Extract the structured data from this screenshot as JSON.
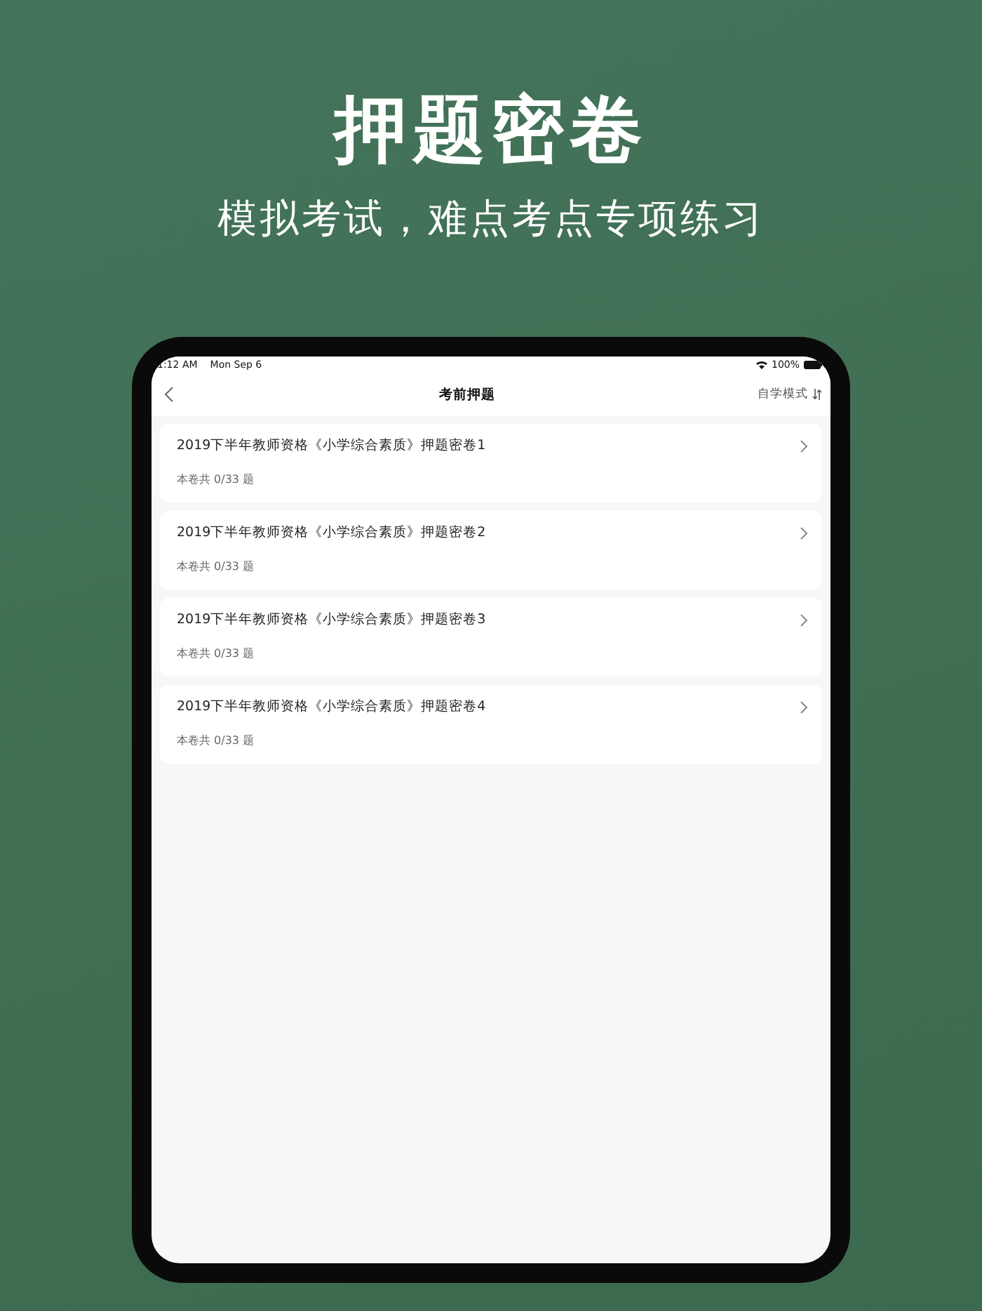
{
  "headline": "押题密卷",
  "subtitle": "模拟考试，难点考点专项练习",
  "status_bar": {
    "time": "1:12 AM",
    "date": "Mon Sep 6",
    "battery": "100%"
  },
  "nav_bar": {
    "title": "考前押题",
    "mode_button": "自学模式"
  },
  "papers": [
    {
      "title": "2019下半年教师资格《小学综合素质》押题密卷1",
      "progress": "本卷共 0/33 题"
    },
    {
      "title": "2019下半年教师资格《小学综合素质》押题密卷2",
      "progress": "本卷共 0/33 题"
    },
    {
      "title": "2019下半年教师资格《小学综合素质》押题密卷3",
      "progress": "本卷共 0/33 题"
    },
    {
      "title": "2019下半年教师资格《小学综合素质》押题密卷4",
      "progress": "本卷共 0/33 题"
    }
  ]
}
